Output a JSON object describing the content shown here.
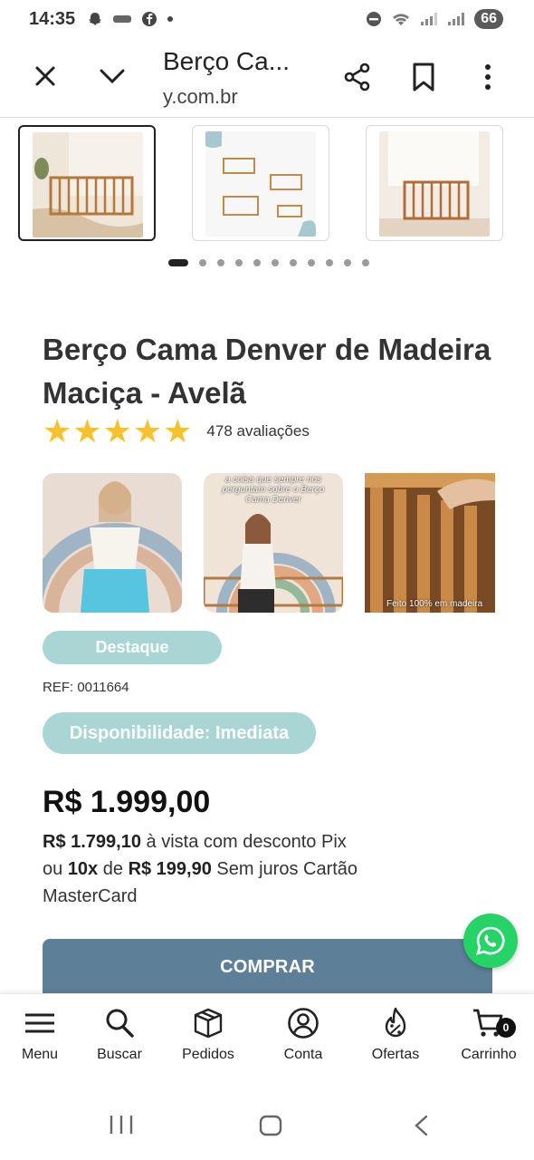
{
  "status_bar": {
    "time": "14:35",
    "battery": "66"
  },
  "browser": {
    "title": "Berço Ca...",
    "url": "y.com.br"
  },
  "gallery": {
    "thumbnail_count": 3,
    "dots_total": 12,
    "active_dot": 0
  },
  "product": {
    "title": "Berço Cama Denver de Madeira Maciça - Avelã",
    "rating_stars": 5,
    "reviews": "478 avaliações",
    "video_caption_2": "a coisa que sempre nos perguntam sobre o Berço Cama Denver",
    "video_caption_3": "Feito 100% em madeira",
    "badge_destaque": "Destaque",
    "ref": "REF: 0011664",
    "availability": "Disponibilidade: Imediata",
    "price": "R$ 1.999,00",
    "pix_price": "R$ 1.799,10",
    "pix_text": "à vista com desconto Pix",
    "installments_prefix": "ou",
    "installments_count": "10x",
    "installments_de": "de",
    "installment_value": "R$ 199,90",
    "installments_suffix": "Sem juros Cartão MasterCard",
    "buy_label": "COMPRAR"
  },
  "bottom_nav": {
    "items": [
      {
        "label": "Menu",
        "icon": "menu-icon"
      },
      {
        "label": "Buscar",
        "icon": "search-icon"
      },
      {
        "label": "Pedidos",
        "icon": "box-icon"
      },
      {
        "label": "Conta",
        "icon": "user-icon"
      },
      {
        "label": "Ofertas",
        "icon": "discount-flame-icon"
      },
      {
        "label": "Carrinho",
        "icon": "cart-icon"
      }
    ],
    "cart_count": "0"
  },
  "colors": {
    "accent_badge": "#a9d6d5",
    "buy_button": "#5d7f98",
    "star": "#f6c12f",
    "whatsapp": "#25d366"
  }
}
